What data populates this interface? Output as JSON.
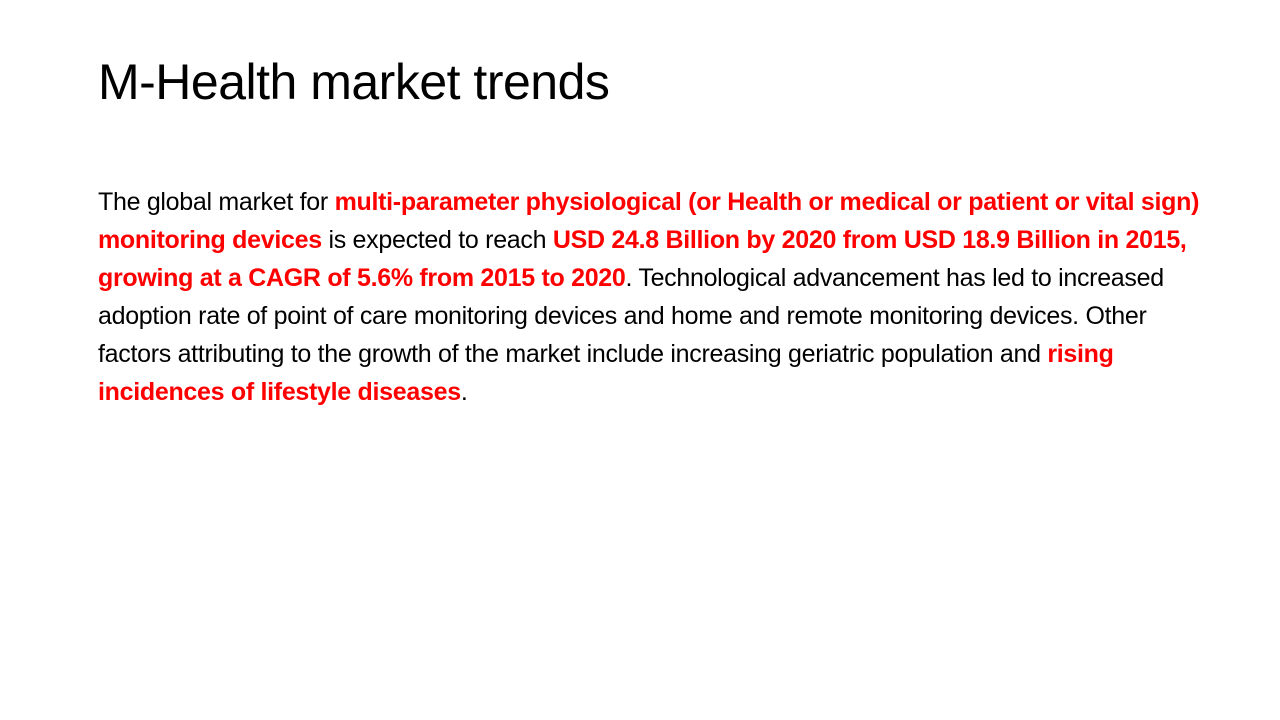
{
  "slide": {
    "title": "M-Health market trends",
    "paragraph": [
      {
        "text": "The global market for ",
        "highlight": false
      },
      {
        "text": "multi-parameter physiological (or Health or medical or patient or vital sign) monitoring devices",
        "highlight": true
      },
      {
        "text": " is expected to reach ",
        "highlight": false
      },
      {
        "text": "USD 24.8 Billion by 2020 from USD 18.9 Billion in 2015, growing at a CAGR of 5.6% from 2015 to 2020",
        "highlight": true
      },
      {
        "text": ". Technological advancement has led to increased adoption rate of point of care monitoring devices and home and remote monitoring devices. Other factors attributing to the growth of the market include increasing geriatric population and ",
        "highlight": false
      },
      {
        "text": "rising incidences of lifestyle diseases",
        "highlight": true
      },
      {
        "text": ".",
        "highlight": false
      }
    ]
  },
  "colors": {
    "text": "#000000",
    "highlight": "#ff0000",
    "background": "#ffffff"
  }
}
